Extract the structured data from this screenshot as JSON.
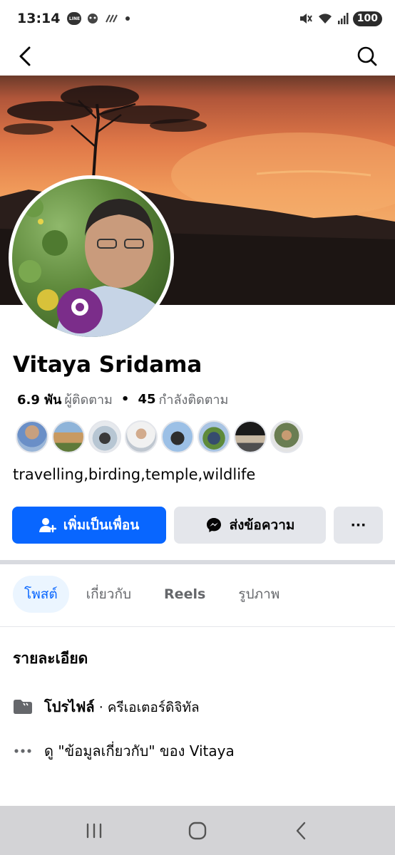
{
  "status_bar": {
    "time": "13:14",
    "line_badge": "LINE",
    "battery": "100"
  },
  "profile": {
    "name": "Vitaya Sridama",
    "followers_count": "6.9 พัน",
    "followers_label": "ผู้ติดตาม",
    "following_count": "45",
    "following_label": "กำลังติดตาม",
    "bio": "travelling,birding,temple,wildlife"
  },
  "actions": {
    "add_friend": "เพิ่มเป็นเพื่อน",
    "message": "ส่งข้อความ",
    "more": "···"
  },
  "tabs": [
    {
      "label": "โพสต์",
      "active": true
    },
    {
      "label": "เกี่ยวกับ",
      "active": false
    },
    {
      "label": "Reels",
      "active": false
    },
    {
      "label": "รูปภาพ",
      "active": false
    }
  ],
  "details": {
    "title": "รายละเอียด",
    "profile_label": "โปรไฟล์",
    "profile_type": " · ครีเอเตอร์ดิจิทัล",
    "see_about": "ดู \"ข้อมูลเกี่ยวกับ\" ของ Vitaya"
  },
  "colors": {
    "accent": "#0866ff",
    "secondary_button": "#e4e6eb",
    "muted_text": "#65676b"
  },
  "icons": {
    "back": "arrow-left",
    "search": "magnifier",
    "add_friend": "person-plus",
    "message": "messenger",
    "profile": "folder",
    "more_info": "ellipsis"
  }
}
